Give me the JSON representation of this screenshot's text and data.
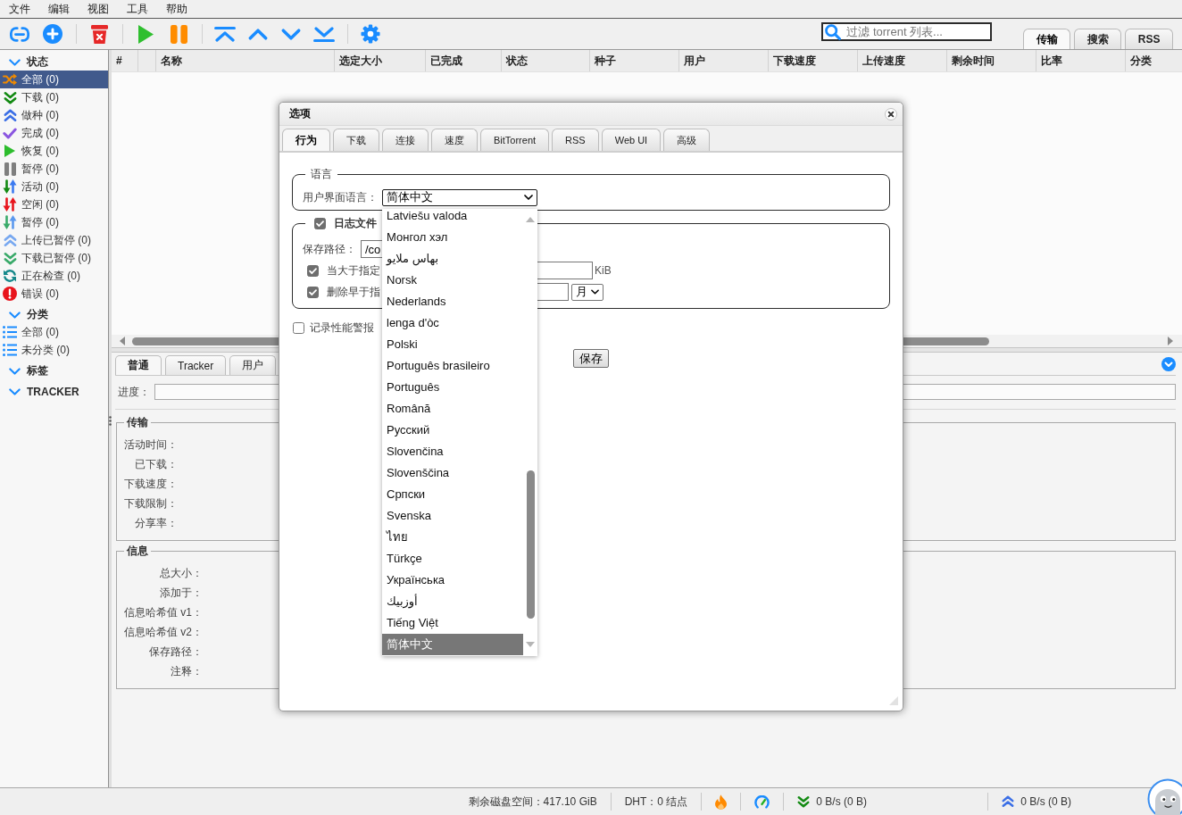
{
  "menu_bar": {
    "items": [
      "文件",
      "编辑",
      "视图",
      "工具",
      "帮助"
    ]
  },
  "toolbar": {
    "search": {
      "placeholder": "过滤 torrent 列表..."
    },
    "tabs": [
      {
        "label": "传输",
        "selected": true
      },
      {
        "label": "搜索",
        "selected": false
      },
      {
        "label": "RSS",
        "selected": false
      }
    ]
  },
  "sidebar": {
    "sections": [
      {
        "title": "状态",
        "expanded": true,
        "items": [
          {
            "label": "全部 (0)",
            "selected": true
          },
          {
            "label": "下载 (0)",
            "selected": false
          },
          {
            "label": "做种 (0)",
            "selected": false
          },
          {
            "label": "完成 (0)",
            "selected": false
          },
          {
            "label": "恢复 (0)",
            "selected": false
          },
          {
            "label": "暂停 (0)",
            "selected": false
          },
          {
            "label": "活动 (0)",
            "selected": false
          },
          {
            "label": "空闲 (0)",
            "selected": false
          },
          {
            "label": "暂停 (0)",
            "selected": false
          },
          {
            "label": "上传已暂停 (0)",
            "selected": false
          },
          {
            "label": "下载已暂停 (0)",
            "selected": false
          },
          {
            "label": "正在检查 (0)",
            "selected": false
          },
          {
            "label": "错误 (0)",
            "selected": false
          }
        ]
      },
      {
        "title": "分类",
        "expanded": true,
        "items": [
          {
            "label": "全部 (0)",
            "selected": false
          },
          {
            "label": "未分类 (0)",
            "selected": false
          }
        ]
      },
      {
        "title": "标签",
        "expanded": true
      },
      {
        "title": "TRACKER",
        "expanded": true
      }
    ]
  },
  "torrent_table": {
    "columns": [
      "#",
      "名称",
      "选定大小",
      "已完成",
      "状态",
      "种子",
      "用户",
      "下载速度",
      "上传速度",
      "剩余时间",
      "比率",
      "分类"
    ]
  },
  "details_panel": {
    "tabs": [
      {
        "label": "普通",
        "selected": true
      },
      {
        "label": "Tracker",
        "selected": false
      },
      {
        "label": "用户",
        "selected": false
      }
    ],
    "progress": {
      "label": "进度：",
      "level": 0
    },
    "transfer": {
      "title": "传输",
      "fields": [
        "活动时间：",
        "已下载：",
        "下载速度：",
        "下载限制：",
        "分享率："
      ]
    },
    "information": {
      "title": "信息",
      "fields": [
        "总大小：",
        "添加于：",
        "信息哈希值 v1：",
        "信息哈希值 v2：",
        "保存路径：",
        "注释："
      ]
    }
  },
  "status_bar": {
    "free_space": "剩余磁盘空间：417.10 GiB",
    "dht": "DHT：0 结点",
    "download_speed": "0 B/s (0 B)",
    "upload_speed": "0 B/s (0 B)"
  },
  "options_dialog": {
    "title": "选项",
    "tabs": [
      {
        "label": "行为",
        "selected": true
      },
      {
        "label": "下载",
        "selected": false
      },
      {
        "label": "连接",
        "selected": false
      },
      {
        "label": "速度",
        "selected": false
      },
      {
        "label": "BitTorrent",
        "selected": false
      },
      {
        "label": "RSS",
        "selected": false
      },
      {
        "label": "Web UI",
        "selected": false
      },
      {
        "label": "高级",
        "selected": false
      }
    ],
    "language": {
      "title": "语言",
      "label": "用户界面语言：",
      "value": "简体中文",
      "expanded": true,
      "options": [
        {
          "label": "Latviešu valoda",
          "selected": false
        },
        {
          "label": "Монгол хэл",
          "selected": false
        },
        {
          "label": "بهاس ملايو",
          "selected": false
        },
        {
          "label": "Norsk",
          "selected": false
        },
        {
          "label": "Nederlands",
          "selected": false
        },
        {
          "label": "lenga d'òc",
          "selected": false
        },
        {
          "label": "Polski",
          "selected": false
        },
        {
          "label": "Português brasileiro",
          "selected": false
        },
        {
          "label": "Português",
          "selected": false
        },
        {
          "label": "Română",
          "selected": false
        },
        {
          "label": "Русский",
          "selected": false
        },
        {
          "label": "Slovenčina",
          "selected": false
        },
        {
          "label": "Slovenščina",
          "selected": false
        },
        {
          "label": "Српски",
          "selected": false
        },
        {
          "label": "Svenska",
          "selected": false
        },
        {
          "label": "ไทย",
          "selected": false
        },
        {
          "label": "Türkçe",
          "selected": false
        },
        {
          "label": "Українська",
          "selected": false
        },
        {
          "label": "أوزبيك",
          "selected": false
        },
        {
          "label": "Tiếng Việt",
          "selected": false
        },
        {
          "label": "简体中文",
          "selected": true
        }
      ]
    },
    "log_file": {
      "title": "日志文件",
      "checked": true,
      "save_path": {
        "label": "保存路径：",
        "value": "/co"
      },
      "backup": {
        "label": "当大于指定",
        "checked": true,
        "unit": "KiB"
      },
      "delete_old": {
        "label": "删除早于指",
        "checked": true,
        "period": "月"
      }
    },
    "performance_warnings": {
      "label": "记录性能警报",
      "checked": false
    },
    "save_button": "保存"
  }
}
